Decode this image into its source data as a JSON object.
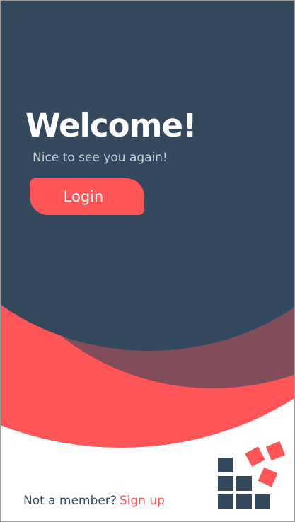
{
  "colors": {
    "primary_dark": "#34495e",
    "accent_red": "#ff5557",
    "background": "#ffffff"
  },
  "welcome": {
    "title": "Welcome!",
    "subtitle": "Nice to see you again!"
  },
  "actions": {
    "login_label": "Login"
  },
  "footer": {
    "prompt": "Not a member?",
    "signup_label": "Sign up"
  },
  "logo": {
    "icon": "blocks-logo-icon"
  }
}
